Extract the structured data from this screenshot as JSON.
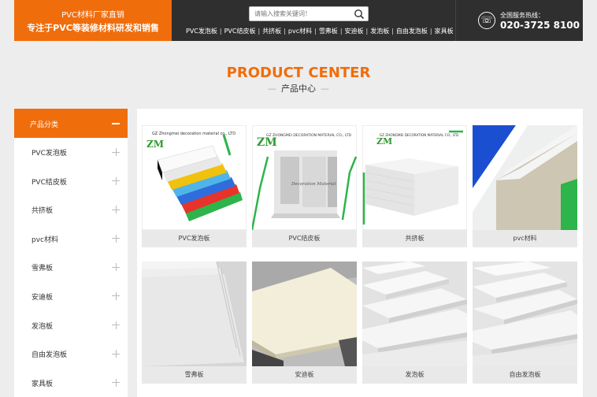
{
  "header": {
    "brand_line1": "PVC材料厂家直销",
    "brand_line2": "专注于PVC等装修材料研发和销售",
    "search_placeholder": "请输入搜索关键词！",
    "nav": [
      "PVC发泡板",
      "PVC结皮板",
      "共挤板",
      "pvc材料",
      "雪弗板",
      "安迪板",
      "发泡板",
      "自由发泡板",
      "家具板"
    ],
    "hotline_label": "全国服务热线：",
    "hotline_number": "020-3725 8100"
  },
  "section": {
    "title_en": "PRODUCT CENTER",
    "title_cn": "产品中心",
    "dash": "—"
  },
  "sidebar": {
    "header": "产品分类",
    "items": [
      "PVC发泡板",
      "PVC结皮板",
      "共挤板",
      "pvc材料",
      "雪弗板",
      "安迪板",
      "发泡板",
      "自由发泡板",
      "家具板"
    ]
  },
  "products": [
    {
      "name": "PVC发泡板",
      "watermark": "GZ Zhongmei decoration material co., LTD",
      "logo": "ZM"
    },
    {
      "name": "PVC结皮板",
      "watermark": "GZ ZHONGMEI DECORATION MATERIAL CO., LTD",
      "logo": "ZM",
      "overlay": "Decoration Material"
    },
    {
      "name": "共挤板",
      "watermark": "GZ ZHONGMEI DECORATION MATERIAL CO., LTD",
      "logo": "ZM"
    },
    {
      "name": "pvc材料"
    },
    {
      "name": "雪弗板"
    },
    {
      "name": "安迪板"
    },
    {
      "name": "发泡板"
    },
    {
      "name": "自由发泡板"
    }
  ],
  "colors": {
    "accent": "#f06d0c",
    "dark": "#2f2f2f"
  }
}
